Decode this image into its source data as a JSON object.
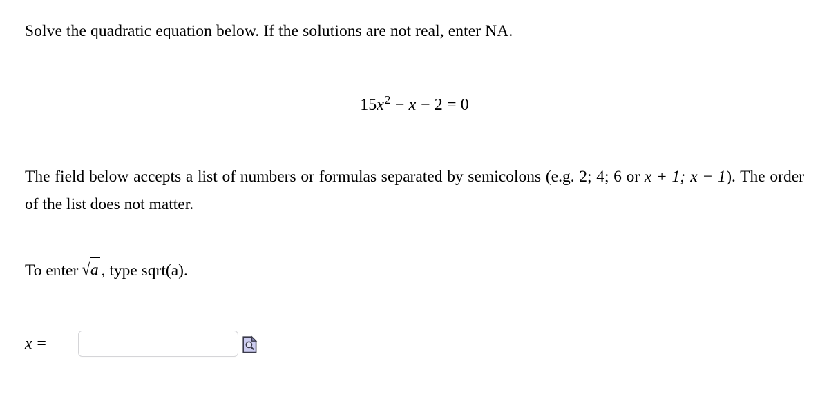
{
  "problem": {
    "prompt": "Solve the quadratic equation below. If the solutions are not real, enter NA.",
    "equation": {
      "latex": "15x^2 - x - 2 = 0",
      "plain": "15x2 - x - 2 = 0",
      "coefficient_a": "15",
      "term1_coefficient": "15",
      "term1_variable": "x",
      "term1_exponent": "2",
      "op1": "−",
      "term2": "x",
      "op2": "−",
      "term3": "2",
      "equals": "=",
      "rhs": "0"
    }
  },
  "instructions": {
    "part1": "The field below accepts a list of numbers or formulas separated by semicolons (e.g. 2; 4; 6 or ",
    "example_expr1": "x + 1;",
    "example_expr2": "x − 1",
    "part2": "). The order of the list does not matter.",
    "full_text": "The field below accepts a list of numbers or formulas separated by semicolons (e.g. 2; 4; 6 or x + 1; x − 1). The order of the list does not matter."
  },
  "sqrt_hint": {
    "lead": "To enter ",
    "radical_sign": "√",
    "radicand": "a",
    "trail": ", type sqrt(a).",
    "full_text": "To enter √a , type sqrt(a)."
  },
  "answer": {
    "label_variable": "x",
    "label_equals": "=",
    "label": "x =",
    "value": "",
    "placeholder": "",
    "preview_icon_name": "document-preview-icon"
  },
  "colors": {
    "page_background": "#ffffff",
    "text": "#000000",
    "input_border": "#d5d5d8",
    "icon_fill": "#ccccf0",
    "icon_stroke": "#3a3a4a",
    "icon_fold": "#8f8fc0"
  }
}
